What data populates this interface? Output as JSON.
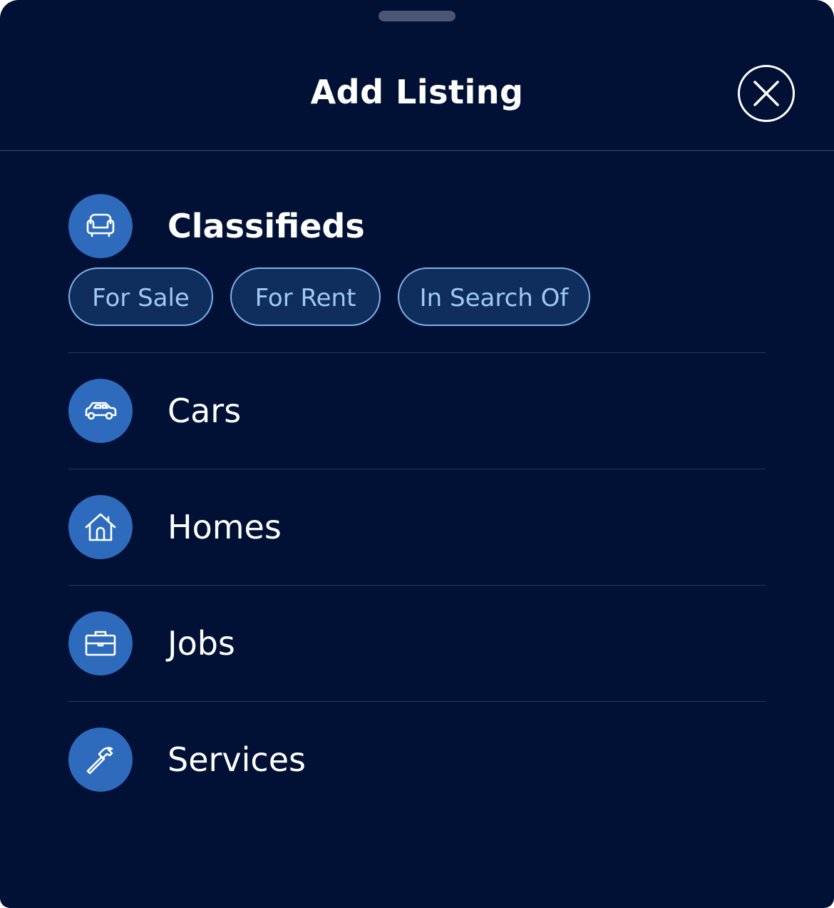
{
  "header": {
    "title": "Add Listing",
    "close_icon": "close-icon"
  },
  "classifieds": {
    "label": "Classifieds",
    "icon": "sofa-icon",
    "chips": [
      "For Sale",
      "For Rent",
      "In Search Of"
    ]
  },
  "categories": [
    {
      "label": "Cars",
      "icon": "car-icon"
    },
    {
      "label": "Homes",
      "icon": "house-icon"
    },
    {
      "label": "Jobs",
      "icon": "briefcase-icon"
    },
    {
      "label": "Services",
      "icon": "hammer-icon"
    }
  ],
  "colors": {
    "background": "#011035",
    "icon_circle": "#2e6bbd",
    "chip_border": "#7fb2e8",
    "chip_text": "#9fcaf2",
    "text": "#ffffff"
  }
}
